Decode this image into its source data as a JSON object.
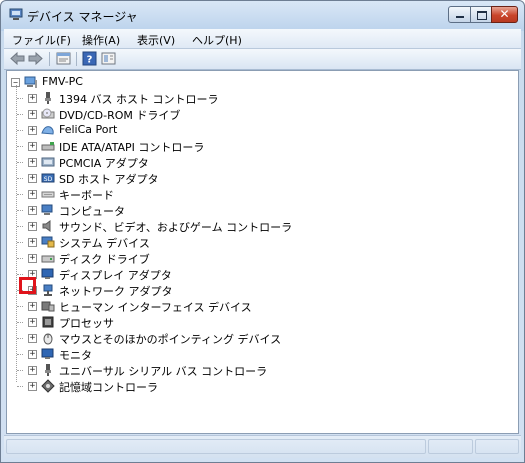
{
  "window": {
    "title": "デバイス マネージャ"
  },
  "menu": {
    "items": [
      {
        "label": "ファイル(F)"
      },
      {
        "label": "操作(A)"
      },
      {
        "label": "表示(V)"
      },
      {
        "label": "ヘルプ(H)"
      }
    ]
  },
  "toolbar": {
    "buttons": [
      "back-arrow-icon",
      "forward-arrow-icon",
      "properties-icon",
      "help-icon",
      "show-hide-icon"
    ]
  },
  "tree": {
    "root": {
      "label": "FMV-PC",
      "expander": "⊟"
    },
    "expander_symbol": "+",
    "items": [
      {
        "label": "1394 バス ホスト コントローラ",
        "icon": "usb-plug-icon"
      },
      {
        "label": "DVD/CD-ROM ドライブ",
        "icon": "optical-drive-icon"
      },
      {
        "label": "FeliCa Port",
        "icon": "felica-icon"
      },
      {
        "label": "IDE ATA/ATAPI コントローラ",
        "icon": "ide-controller-icon"
      },
      {
        "label": "PCMCIA アダプタ",
        "icon": "pcmcia-icon"
      },
      {
        "label": "SD ホスト アダプタ",
        "icon": "sd-card-icon"
      },
      {
        "label": "キーボード",
        "icon": "keyboard-icon"
      },
      {
        "label": "コンピュータ",
        "icon": "computer-icon"
      },
      {
        "label": "サウンド、ビデオ、およびゲーム コントローラ",
        "icon": "speaker-icon"
      },
      {
        "label": "システム デバイス",
        "icon": "system-device-icon"
      },
      {
        "label": "ディスク ドライブ",
        "icon": "disk-drive-icon"
      },
      {
        "label": "ディスプレイ アダプタ",
        "icon": "display-adapter-icon"
      },
      {
        "label": "ネットワーク アダプタ",
        "icon": "network-adapter-icon"
      },
      {
        "label": "ヒューマン インターフェイス デバイス",
        "icon": "hid-icon"
      },
      {
        "label": "プロセッサ",
        "icon": "processor-icon"
      },
      {
        "label": "マウスとそのほかのポインティング デバイス",
        "icon": "mouse-icon"
      },
      {
        "label": "モニタ",
        "icon": "monitor-icon"
      },
      {
        "label": "ユニバーサル シリアル バス コントローラ",
        "icon": "usb-controller-icon"
      },
      {
        "label": "記憶域コントローラ",
        "icon": "storage-controller-icon"
      }
    ]
  },
  "colors": {
    "highlight_box": "#e0141b",
    "title_bar": "#bcd3ec",
    "close_button": "#c9452b"
  }
}
